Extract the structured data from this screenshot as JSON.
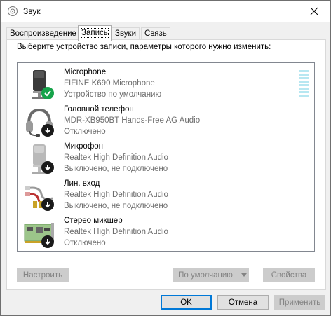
{
  "window": {
    "title": "Звук"
  },
  "tabs": [
    {
      "label": "Воспроизведение",
      "active": false
    },
    {
      "label": "Запись",
      "active": true
    },
    {
      "label": "Звуки",
      "active": false
    },
    {
      "label": "Связь",
      "active": false
    }
  ],
  "instruction": "Выберите устройство записи, параметры которого нужно изменить:",
  "devices": [
    {
      "name": "Microphone",
      "driver": "FIFINE K690 Microphone",
      "status": "Устройство по умолчанию",
      "icon": "microphone-icon",
      "badge": "default-check-icon"
    },
    {
      "name": "Головной телефон",
      "driver": "MDR-XB950BT Hands-Free AG Audio",
      "status": "Отключено",
      "icon": "headset-icon",
      "badge": "disabled-arrow-icon"
    },
    {
      "name": "Микрофон",
      "driver": "Realtek High Definition Audio",
      "status": "Выключено, не подключено",
      "icon": "microphone-icon",
      "badge": "disabled-arrow-icon"
    },
    {
      "name": "Лин. вход",
      "driver": "Realtek High Definition Audio",
      "status": "Выключено, не подключено",
      "icon": "line-in-cable-icon",
      "badge": "disabled-arrow-icon"
    },
    {
      "name": "Стерео микшер",
      "driver": "Realtek High Definition Audio",
      "status": "Отключено",
      "icon": "sound-card-icon",
      "badge": "disabled-arrow-icon"
    }
  ],
  "buttons": {
    "configure": "Настроить",
    "default": "По умолчанию",
    "properties": "Свойства",
    "ok": "OK",
    "cancel": "Отмена",
    "apply": "Применить"
  },
  "colors": {
    "accent": "#0078d7",
    "default_badge": "#16a34a",
    "level_meter": "#b7e7f1"
  }
}
